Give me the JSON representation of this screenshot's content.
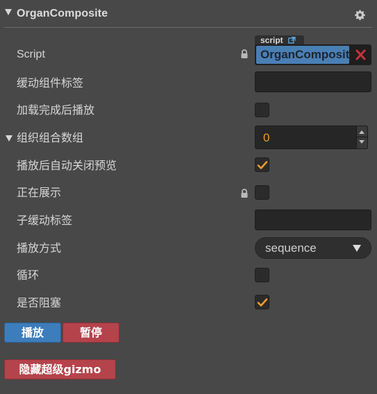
{
  "component": {
    "title": "OrganComposite"
  },
  "properties": {
    "script": {
      "label": "Script",
      "tag": "script",
      "value": "OrganComposite"
    },
    "tween_tag": {
      "label": "缓动组件标签",
      "value": ""
    },
    "play_after_load": {
      "label": "加载完成后播放",
      "checked": false
    },
    "organ_array": {
      "label": "组织组合数组",
      "value": "0"
    },
    "auto_close_preview": {
      "label": "播放后自动关闭预览",
      "checked": true
    },
    "showing": {
      "label": "正在展示",
      "checked": false
    },
    "child_tween_tag": {
      "label": "子缓动标签",
      "value": ""
    },
    "play_mode": {
      "label": "播放方式",
      "value": "sequence"
    },
    "loop": {
      "label": "循环",
      "checked": false
    },
    "blocking": {
      "label": "是否阻塞",
      "checked": true
    }
  },
  "buttons": {
    "play": "播放",
    "pause": "暂停",
    "hide_gizmo": "隐藏超级gizmo"
  },
  "colors": {
    "background": "#484848",
    "accent_orange": "#f09b2b",
    "script_blue": "#4a7fb5",
    "button_blue": "#3d7dbb",
    "button_red": "#b5434b",
    "clear_red": "#c9313a"
  },
  "icons": {
    "header_collapse": "triangle-down-icon",
    "settings": "gear-icon",
    "lock": "lock-icon",
    "external_link": "external-link-icon",
    "clear": "close-x-icon",
    "check": "checkmark-icon"
  }
}
